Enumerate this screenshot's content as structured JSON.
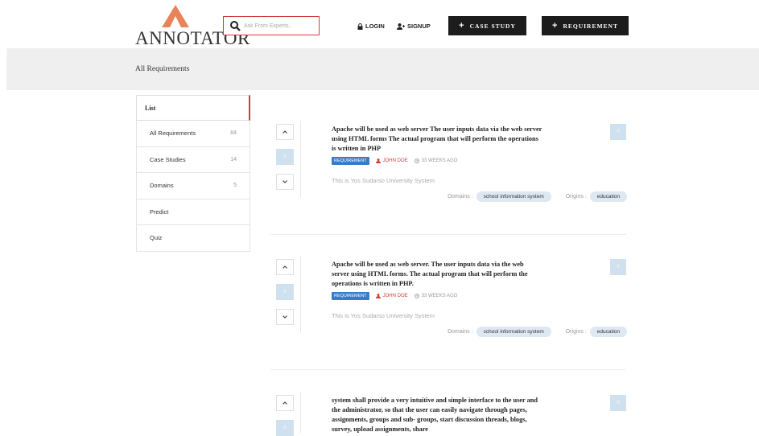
{
  "header": {
    "logo_text": "ANNOTATOR",
    "search": {
      "placeholder": "Ask From Experts.."
    },
    "login_label": "LOGIN",
    "signup_label": "SIGNUP",
    "case_study_label": "CASE STUDY",
    "requirement_label": "REQUIREMENT",
    "logo_color": "#e8835a"
  },
  "banner": {
    "title": "All Requirements"
  },
  "sidebar": {
    "heading": "List",
    "items": [
      {
        "label": "All Requirements",
        "count": "84"
      },
      {
        "label": "Case Studies",
        "count": "14"
      },
      {
        "label": "Domains",
        "count": "5"
      },
      {
        "label": "Predict",
        "count": ""
      },
      {
        "label": "Quiz",
        "count": ""
      }
    ]
  },
  "questions": [
    {
      "title": "Apache will be used as web server The user inputs data via the web server using HTML forms The actual program that will perform the operations is written in PHP",
      "badge": "REQUIREMENT",
      "author": "JOHN DOE",
      "ago": "33 WEEKS AGO",
      "description": "This is Yos Sudarso University System",
      "votes": "0",
      "answers": "0",
      "domains_label": "Domains :",
      "domain": "school information system",
      "origins_label": "Origins :",
      "origin": "education"
    },
    {
      "title": "Apache will be used as web server. The user inputs data via the web server using HTML forms. The actual program that will perform the operations is written in PHP.",
      "badge": "REQUIREMENT",
      "author": "JOHN DOE",
      "ago": "33 WEEKS AGO",
      "description": "This is Yos Sudarso University System",
      "votes": "0",
      "answers": "0",
      "domains_label": "Domains :",
      "domain": "school information system",
      "origins_label": "Origins :",
      "origin": "education"
    },
    {
      "title": "system shall provide a very intuitive and simple interface to the user and the administrator, so that the user can easily navigate through pages, assignments, groups and sub- groups, start discussion threads, blogs, survey, upload assignments, share",
      "votes": "0",
      "answers": "0"
    }
  ],
  "colors": {
    "accent": "#d23a3a",
    "badge": "#3a7bc8",
    "dark_button": "#1c1c1c",
    "vote_box": "#cfe0ee"
  }
}
